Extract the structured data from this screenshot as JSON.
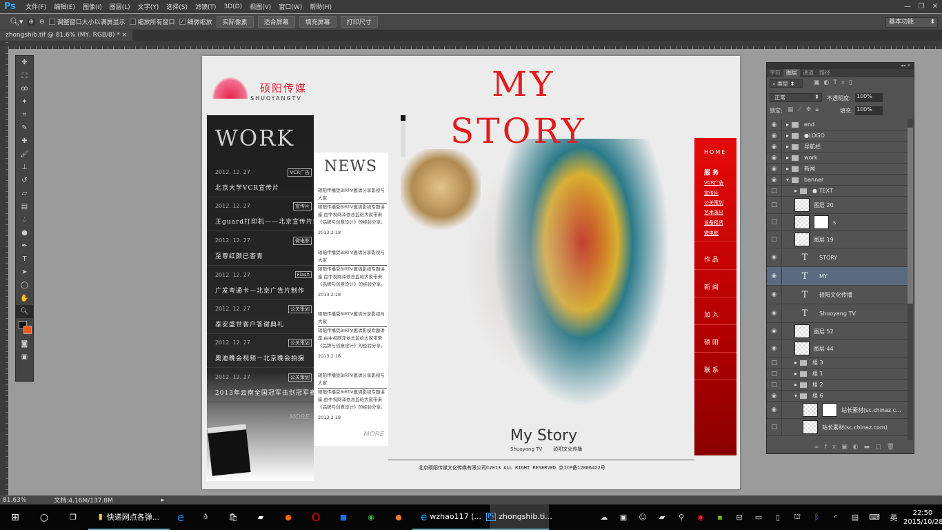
{
  "app": {
    "logo": "Ps",
    "menus": [
      "文件(F)",
      "编辑(E)",
      "图像(I)",
      "图层(L)",
      "文字(Y)",
      "选择(S)",
      "滤镜(T)",
      "3D(D)",
      "视图(V)",
      "窗口(W)",
      "帮助(H)"
    ]
  },
  "options": {
    "checks": [
      {
        "label": "调整窗口大小以满屏显示",
        "checked": false
      },
      {
        "label": "缩放所有窗口",
        "checked": false
      },
      {
        "label": "细微缩放",
        "checked": true
      }
    ],
    "buttons": [
      "实际像素",
      "适合屏幕",
      "填充屏幕",
      "打印尺寸"
    ],
    "workspace": "基本功能"
  },
  "tab": {
    "title": "zhongshib.tif @ 81.6% (MY, RGB/8) *",
    "close": "×"
  },
  "page": {
    "logo": {
      "cn": "硕阳传媒",
      "en": "SHUOYANGTV"
    },
    "title_line1": "MY",
    "title_line2": "STORY",
    "work": {
      "title": "WORK",
      "more": "MORE",
      "items": [
        {
          "date": "2012. 12. 27",
          "tag": "VCR广告",
          "title": "北京大学VCR宣传片"
        },
        {
          "date": "2012. 12. 27",
          "tag": "宣传片",
          "title": "王guard打印机——北京宣传片制作"
        },
        {
          "date": "2012. 12. 27",
          "tag": "微电影",
          "title": "至尊红颜已杳青"
        },
        {
          "date": "2012. 12. 27",
          "tag": "Flash",
          "title": "广发粤通卡—北京广告片制作"
        },
        {
          "date": "2012. 12. 27",
          "tag": "公关策划",
          "title": "泰安盛世客户答谢典礼"
        },
        {
          "date": "2012. 12. 27",
          "tag": "公关策划",
          "title": "奥迪晚会视频－北京晚会拍摄"
        },
        {
          "date": "2012. 12. 27",
          "tag": "公关策划",
          "title": "2013年云南全国冠军击剑冠军赛"
        }
      ]
    },
    "news": {
      "title": "NEWS",
      "more": "MORE",
      "items": [
        {
          "head": "硕阳传播受BIRTV邀请分享影视与大家",
          "body": "硕阳传播受BIRTV邀请影视专题讲座,由中视网泽依总监给大家带来《品牌与创意设计》的经验分享。",
          "date": "2013.2.18"
        },
        {
          "head": "硕阳传播受BIRTV邀请分享影视与大家",
          "body": "硕阳传播受BIRTV邀请影视专题讲座,由中视网泽依总监给大家带来《品牌与创意设计》的经验分享。",
          "date": "2013.2.18"
        },
        {
          "head": "硕阳传播受BIRTV邀请分享影视与大家",
          "body": "硕阳传播受BIRTV邀请影视专题讲座,由中视网泽依总监给大家带来《品牌与创意设计》的经验分享。",
          "date": "2013.2.18"
        },
        {
          "head": "硕阳传播受BIRTV邀请分享影视与大家",
          "body": "硕阳传播受BIRTV邀请影视专题讲座,由中视网泽依总监给大家带来《品牌与创意设计》的经验分享。",
          "date": "2013.2.18"
        }
      ]
    },
    "nav": {
      "home": "HOME",
      "service": "服 务",
      "subs": [
        "VCR广告",
        "宣传片",
        "公关策划",
        "艺术演出",
        "设备租赁",
        "微电影"
      ],
      "main": [
        "作 品",
        "新 闻",
        "加 入",
        "硕 阳",
        "联 系"
      ]
    },
    "story": {
      "title": "My Story",
      "en": "Shuoyang TV",
      "cn": "硕阳文化传播"
    },
    "footer": "北京硕阳传媒文化传媒有限公司©2013   ALL RIGHT RESERVED  京ICP备12006422号"
  },
  "layers": {
    "tabs": [
      "字符",
      "图层",
      "通道",
      "路径"
    ],
    "filter": "类型",
    "blend": "正常",
    "opacity_label": "不透明度:",
    "opacity": "100%",
    "lock_label": "锁定:",
    "fill_label": "填充:",
    "fill": "100%",
    "rows": [
      {
        "name": "end",
        "type": "folder",
        "visible": true,
        "indent": 0
      },
      {
        "name": "●LOGO",
        "type": "folder",
        "visible": true,
        "indent": 0
      },
      {
        "name": "导航栏",
        "type": "folder",
        "visible": true,
        "indent": 0
      },
      {
        "name": "work",
        "type": "folder",
        "visible": true,
        "indent": 0
      },
      {
        "name": "新闻",
        "type": "folder",
        "visible": true,
        "indent": 0
      },
      {
        "name": "banner",
        "type": "folder-open",
        "visible": true,
        "indent": 0
      },
      {
        "name": "● TEXT",
        "type": "folder",
        "visible": false,
        "indent": 1
      },
      {
        "name": "图层 20",
        "type": "image",
        "visible": false,
        "indent": 1
      },
      {
        "name": "s",
        "type": "image-mask",
        "visible": false,
        "indent": 1
      },
      {
        "name": "图层 19",
        "type": "image",
        "visible": false,
        "indent": 1
      },
      {
        "name": "STORY",
        "type": "text",
        "visible": true,
        "indent": 1
      },
      {
        "name": "MY",
        "type": "text",
        "visible": true,
        "indent": 1,
        "selected": true
      },
      {
        "name": "硕阳文化传播",
        "type": "text",
        "visible": true,
        "indent": 1
      },
      {
        "name": "Shuoyang TV",
        "type": "text",
        "visible": true,
        "indent": 1
      },
      {
        "name": "图层 52",
        "type": "image",
        "visible": true,
        "indent": 1
      },
      {
        "name": "图层 44",
        "type": "image",
        "visible": true,
        "indent": 1
      },
      {
        "name": "组 3",
        "type": "folder",
        "visible": false,
        "indent": 1
      },
      {
        "name": "组 1",
        "type": "folder",
        "visible": false,
        "indent": 1
      },
      {
        "name": "组 2",
        "type": "folder",
        "visible": false,
        "indent": 1
      },
      {
        "name": "组 6",
        "type": "folder-open",
        "visible": true,
        "indent": 1
      },
      {
        "name": "站长素材(sc.chinaz.c...",
        "type": "image-mask",
        "visible": true,
        "indent": 2
      },
      {
        "name": "站长素材(sc.chinaz.com)",
        "type": "image",
        "visible": false,
        "indent": 2
      }
    ]
  },
  "status": {
    "zoom": "81.63%",
    "doc": "文档:4.16M/137.8M"
  },
  "taskbar": {
    "items": [
      {
        "label": "快递网点各弹...",
        "icon": "folder-icon"
      },
      {
        "label": "wzhao117 (...",
        "icon": "ie-icon"
      },
      {
        "label": "zhongshib.ti...",
        "icon": "photoshop-icon"
      }
    ],
    "ime": "英",
    "time": "22:50",
    "date": "2015/10/28"
  }
}
